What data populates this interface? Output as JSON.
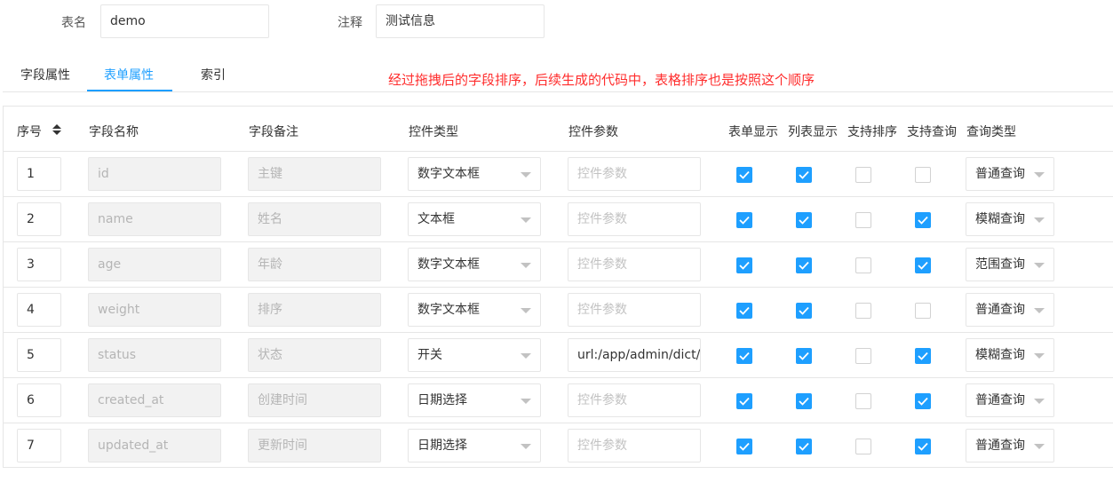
{
  "form": {
    "table_name_label": "表名",
    "table_name_value": "demo",
    "comment_label": "注释",
    "comment_value": "测试信息"
  },
  "tabs": [
    {
      "label": "字段属性",
      "active": false
    },
    {
      "label": "表单属性",
      "active": true
    },
    {
      "label": "索引",
      "active": false
    }
  ],
  "note": "经过拖拽后的字段排序，后续生成的代码中，表格排序也是按照这个顺序",
  "table": {
    "headers": [
      "序号",
      "字段名称",
      "字段备注",
      "控件类型",
      "控件参数",
      "表单显示",
      "列表显示",
      "支持排序",
      "支持查询",
      "查询类型"
    ],
    "param_placeholder": "控件参数",
    "rows": [
      {
        "index": "1",
        "field": "id",
        "comment": "主键",
        "control": "数字文本框",
        "param": "",
        "form_show": true,
        "list_show": true,
        "sortable": false,
        "searchable": false,
        "query_type": "普通查询"
      },
      {
        "index": "2",
        "field": "name",
        "comment": "姓名",
        "control": "文本框",
        "param": "",
        "form_show": true,
        "list_show": true,
        "sortable": false,
        "searchable": true,
        "query_type": "模糊查询"
      },
      {
        "index": "3",
        "field": "age",
        "comment": "年龄",
        "control": "数字文本框",
        "param": "",
        "form_show": true,
        "list_show": true,
        "sortable": false,
        "searchable": true,
        "query_type": "范围查询"
      },
      {
        "index": "4",
        "field": "weight",
        "comment": "排序",
        "control": "数字文本框",
        "param": "",
        "form_show": true,
        "list_show": true,
        "sortable": false,
        "searchable": false,
        "query_type": "普通查询"
      },
      {
        "index": "5",
        "field": "status",
        "comment": "状态",
        "control": "开关",
        "param": "url:/app/admin/dict/get",
        "form_show": true,
        "list_show": true,
        "sortable": false,
        "searchable": true,
        "query_type": "模糊查询"
      },
      {
        "index": "6",
        "field": "created_at",
        "comment": "创建时间",
        "control": "日期选择",
        "param": "",
        "form_show": true,
        "list_show": true,
        "sortable": false,
        "searchable": true,
        "query_type": "普通查询"
      },
      {
        "index": "7",
        "field": "updated_at",
        "comment": "更新时间",
        "control": "日期选择",
        "param": "",
        "form_show": true,
        "list_show": true,
        "sortable": false,
        "searchable": true,
        "query_type": "普通查询"
      }
    ]
  },
  "colors": {
    "accent": "#1e9fff",
    "note": "#ff2d2d"
  }
}
